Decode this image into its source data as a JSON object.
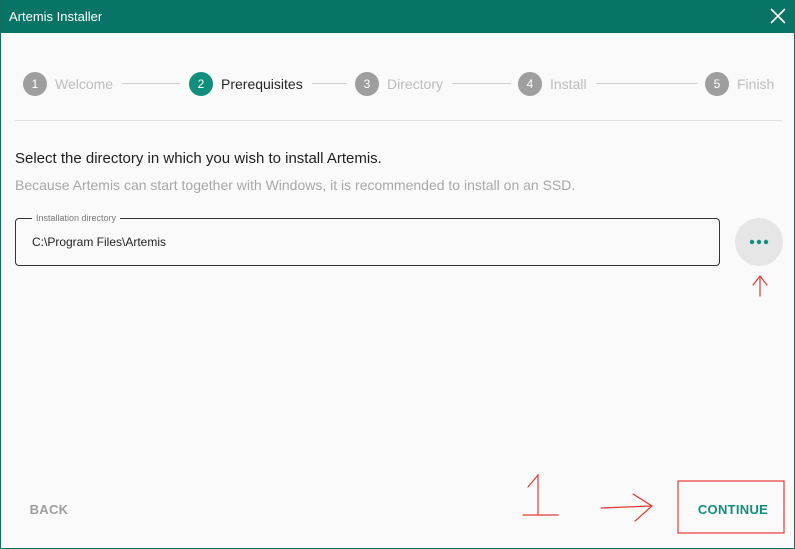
{
  "window": {
    "title": "Artemis Installer"
  },
  "steps": [
    {
      "number": "1",
      "label": "Welcome",
      "state": "inactive"
    },
    {
      "number": "2",
      "label": "Prerequisites",
      "state": "active"
    },
    {
      "number": "3",
      "label": "Directory",
      "state": "inactive"
    },
    {
      "number": "4",
      "label": "Install",
      "state": "inactive"
    },
    {
      "number": "5",
      "label": "Finish",
      "state": "inactive"
    }
  ],
  "content": {
    "heading": "Select the directory in which you wish to install Artemis.",
    "subtext": "Because Artemis can start together with Windows, it is recommended to install on an SSD.",
    "directory_field": {
      "label": "Installation directory",
      "value": "C:\\Program Files\\Artemis"
    },
    "browse_icon": "more-horizontal-icon"
  },
  "footer": {
    "back_label": "BACK",
    "continue_label": "CONTINUE"
  },
  "annotations": {
    "handwritten_number": "1",
    "color": "#e53935"
  },
  "colors": {
    "titlebar": "#087465",
    "accent": "#10907c",
    "inactive_step": "#9e9e9e"
  }
}
